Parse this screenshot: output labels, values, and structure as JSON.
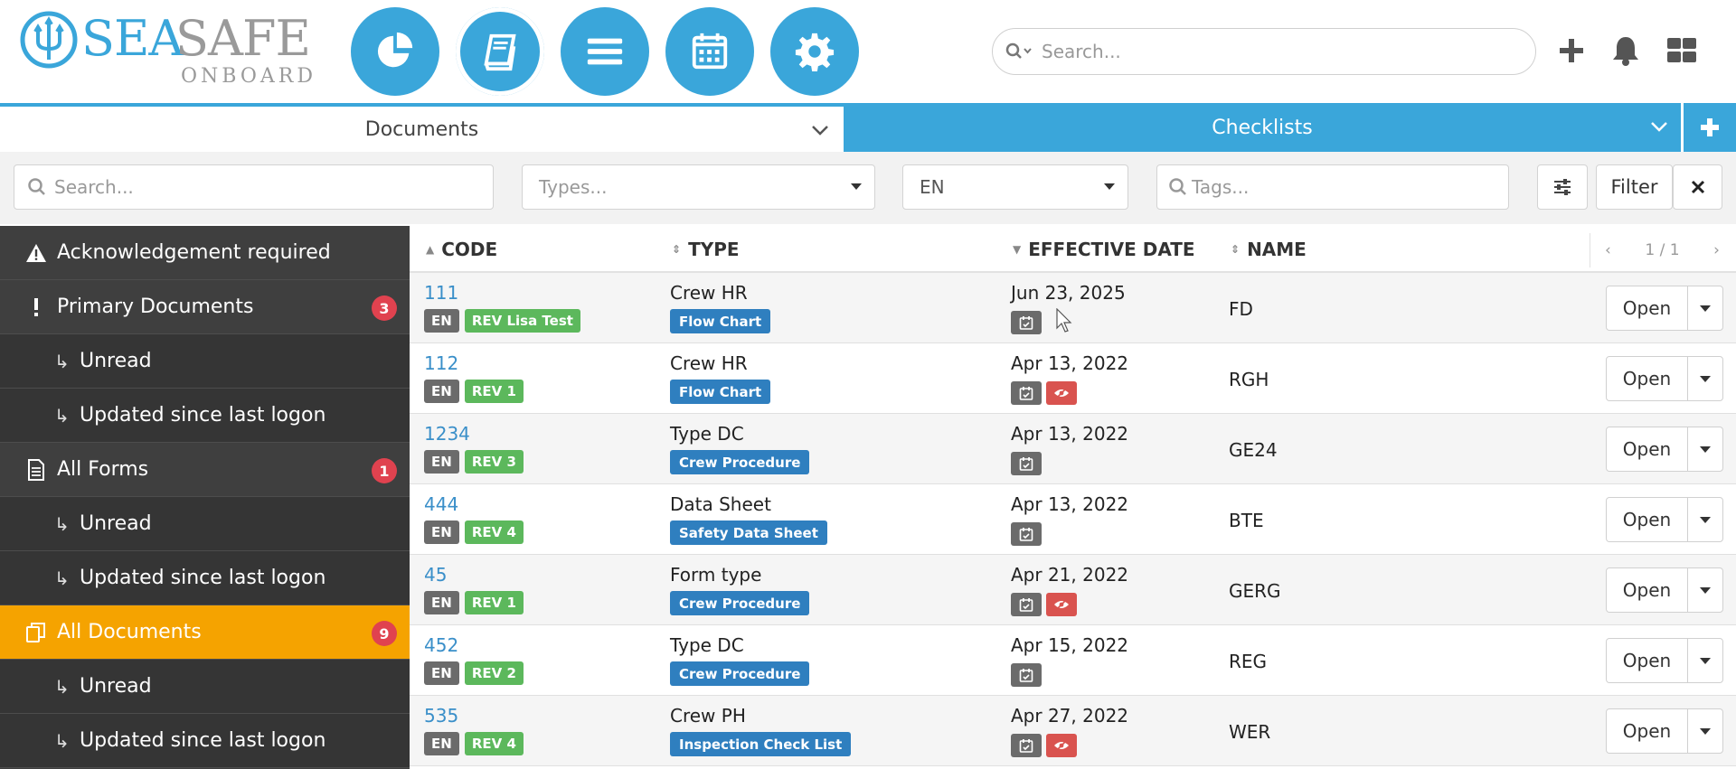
{
  "app": {
    "logo_sea": "SEA",
    "logo_safe": "SAFE",
    "logo_onboard": "ONBOARD"
  },
  "nav": [
    {
      "name": "dashboard",
      "icon": "pie-chart-icon"
    },
    {
      "name": "documents",
      "icon": "book-icon",
      "active": true
    },
    {
      "name": "list",
      "icon": "list-icon"
    },
    {
      "name": "calendar",
      "icon": "calendar-icon"
    },
    {
      "name": "settings",
      "icon": "gear-icon"
    }
  ],
  "global_search": {
    "placeholder": "Search..."
  },
  "header_icons": [
    "plus-icon",
    "bell-icon",
    "grid-icon"
  ],
  "tabs": {
    "documents": "Documents",
    "checklists": "Checklists"
  },
  "filters": {
    "search_placeholder": "Search...",
    "types_placeholder": "Types...",
    "language_value": "EN",
    "tags_placeholder": "Tags...",
    "filter_label": "Filter"
  },
  "sidebar": {
    "items": [
      {
        "label": "Acknowledgement required",
        "icon": "warning-icon"
      },
      {
        "label": "Primary Documents",
        "icon": "exclamation-icon",
        "badge": "3"
      },
      {
        "label": "Unread",
        "sub": true
      },
      {
        "label": "Updated since last logon",
        "sub": true
      },
      {
        "label": "All Forms",
        "icon": "document-icon",
        "badge": "1"
      },
      {
        "label": "Unread",
        "sub": true
      },
      {
        "label": "Updated since last logon",
        "sub": true
      },
      {
        "label": "All Documents",
        "icon": "copy-icon",
        "badge": "9",
        "active": true
      },
      {
        "label": "Unread",
        "sub": true
      },
      {
        "label": "Updated since last logon",
        "sub": true
      }
    ]
  },
  "table": {
    "columns": {
      "code": "CODE",
      "type": "TYPE",
      "effective_date": "EFFECTIVE DATE",
      "name": "NAME"
    },
    "pager": {
      "prev": "‹",
      "text": "1 / 1",
      "next": "›"
    },
    "open_label": "Open",
    "rows": [
      {
        "code": "111",
        "lang": "EN",
        "rev": "REV Lisa Test",
        "type": "Crew HR",
        "type_tag": "Flow Chart",
        "date": "Jun 23, 2025",
        "hidden": false,
        "name": "FD"
      },
      {
        "code": "112",
        "lang": "EN",
        "rev": "REV 1",
        "type": "Crew HR",
        "type_tag": "Flow Chart",
        "date": "Apr 13, 2022",
        "hidden": true,
        "name": "RGH"
      },
      {
        "code": "1234",
        "lang": "EN",
        "rev": "REV 3",
        "type": "Type DC",
        "type_tag": "Crew Procedure",
        "date": "Apr 13, 2022",
        "hidden": false,
        "name": "GE24"
      },
      {
        "code": "444",
        "lang": "EN",
        "rev": "REV 4",
        "type": "Data Sheet",
        "type_tag": "Safety Data Sheet",
        "date": "Apr 13, 2022",
        "hidden": false,
        "name": "BTE"
      },
      {
        "code": "45",
        "lang": "EN",
        "rev": "REV 1",
        "type": "Form type",
        "type_tag": "Crew Procedure",
        "date": "Apr 21, 2022",
        "hidden": true,
        "name": "GERG"
      },
      {
        "code": "452",
        "lang": "EN",
        "rev": "REV 2",
        "type": "Type DC",
        "type_tag": "Crew Procedure",
        "date": "Apr 15, 2022",
        "hidden": false,
        "name": "REG"
      },
      {
        "code": "535",
        "lang": "EN",
        "rev": "REV 4",
        "type": "Crew PH",
        "type_tag": "Inspection Check List",
        "date": "Apr 27, 2022",
        "hidden": true,
        "name": "WER"
      }
    ]
  },
  "colors": {
    "brand_blue": "#3aa6da",
    "active_orange": "#f5a300",
    "badge_red": "#e0424f",
    "rev_green": "#5cb85c",
    "type_blue": "#2f7fbf"
  }
}
